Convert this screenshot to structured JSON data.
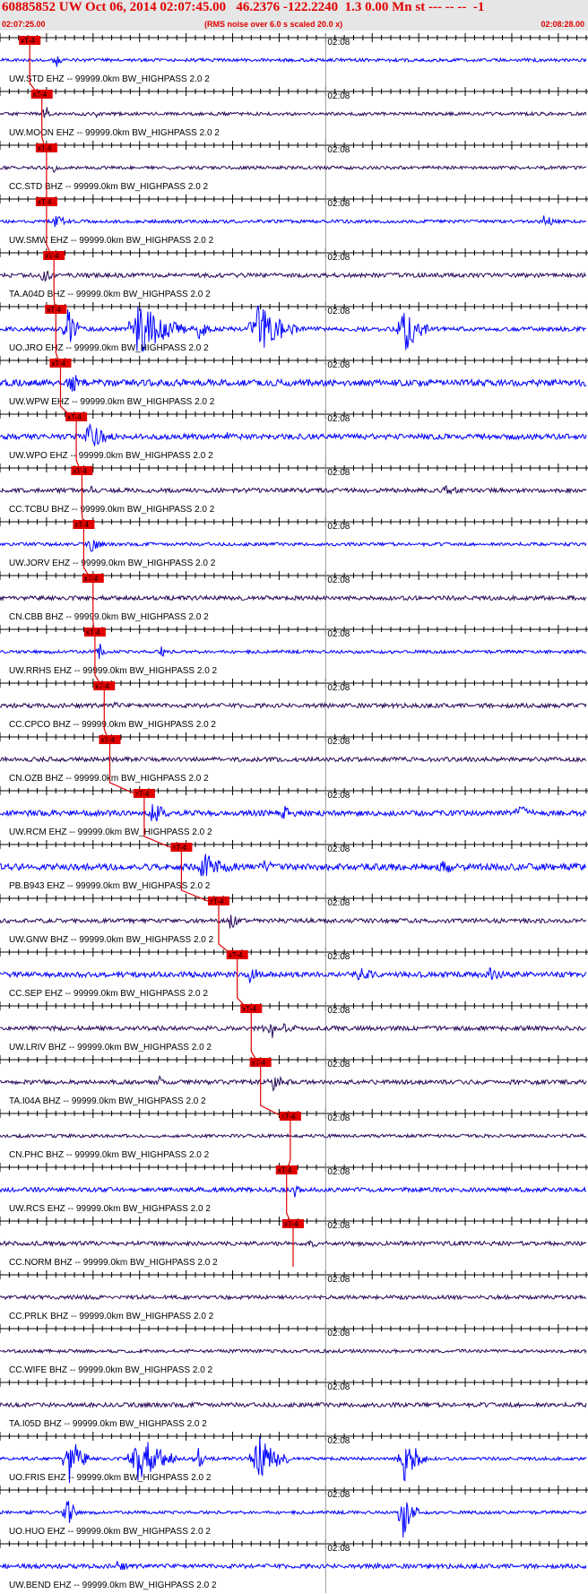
{
  "header": {
    "title": "60885852 UW Oct 06, 2014 02:07:45.00   46.2376 -122.2240  1.3 0.00 Mn st --- -- --  -1",
    "subtitle": "(RMS noise over 6.0 s scaled 20.0 x)",
    "time_start": "02:07:25.00",
    "time_end": "02:08:28.00"
  },
  "chart_data": {
    "type": "line",
    "title": "60885852 UW Oct 06, 2014 02:07:45.00   46.2376 -122.2240  1.3 0.00 Mn st --- -- --  -1",
    "subtitle": "(RMS noise over 6.0 s scaled 20.0 x)",
    "x_range": [
      "02:07:25.00",
      "02:08:28.00"
    ],
    "minute_mark_label": "02:08",
    "pick_label": "xT-4",
    "colors": {
      "trace_blue": "#0000ff",
      "trace_dark": "#2a0a5a",
      "pick": "#e00000",
      "axis": "#000000"
    },
    "traces": [
      {
        "label": "UW.STD EHZ -- 99999.0km BW_HIGHPASS  2.0  2",
        "color": "blue",
        "pick_s": 3.2,
        "amp": 0.15,
        "events": [
          [
            6,
            1.0,
            0.9
          ],
          [
            18,
            0.7,
            0.3
          ],
          [
            45,
            0.8,
            0.3
          ]
        ]
      },
      {
        "label": "UW.MOON EHZ -- 99999.0km BW_HIGHPASS  2.0  2",
        "color": "dark",
        "pick_s": 4.5,
        "amp": 0.15,
        "events": [
          [
            4.8,
            0.6,
            1.2
          ],
          [
            10,
            1.5,
            0.4
          ]
        ]
      },
      {
        "label": "CC.STD BHZ -- 99999.0km BW_HIGHPASS  2.0  2",
        "color": "dark",
        "pick_s": 5.0,
        "amp": 0.15,
        "events": [
          [
            5.5,
            1.5,
            0.5
          ]
        ]
      },
      {
        "label": "UW.SMW EHZ -- 99999.0km BW_HIGHPASS  2.0  2",
        "color": "blue",
        "pick_s": 5.0,
        "amp": 0.15,
        "events": [
          [
            5.5,
            3,
            0.7
          ],
          [
            58,
            3,
            0.6
          ]
        ]
      },
      {
        "label": "TA.A04D BHZ -- 99999.0km BW_HIGHPASS  2.0  2",
        "color": "dark",
        "pick_s": 5.8,
        "amp": 0.2,
        "events": [
          [
            4,
            4,
            0.6
          ]
        ]
      },
      {
        "label": "UO.JRO EHZ -- 99999.0km BW_HIGHPASS  2.0  2",
        "color": "blue",
        "pick_s": 6.0,
        "amp": 0.2,
        "events": [
          [
            7,
            2,
            2.2
          ],
          [
            14,
            6,
            2.6
          ],
          [
            21,
            2,
            1.2
          ],
          [
            27,
            5,
            2.6
          ],
          [
            43,
            3,
            2.6
          ]
        ]
      },
      {
        "label": "UW.WPW EHZ -- 99999.0km BW_HIGHPASS  2.0  2",
        "color": "blue",
        "pick_s": 6.5,
        "amp": 0.3,
        "events": [
          [
            7,
            3,
            1.2
          ]
        ]
      },
      {
        "label": "UW.WPO EHZ -- 99999.0km BW_HIGHPASS  2.0  2",
        "color": "blue",
        "pick_s": 8.2,
        "amp": 0.25,
        "events": [
          [
            9,
            4,
            1.3
          ],
          [
            24,
            2,
            0.5
          ]
        ]
      },
      {
        "label": "CC.TCBU BHZ -- 99999.0km BW_HIGHPASS  2.0  2",
        "color": "dark",
        "pick_s": 8.8,
        "amp": 0.2,
        "events": [
          [
            9.5,
            2,
            0.4
          ],
          [
            47,
            4,
            0.6
          ]
        ]
      },
      {
        "label": "UW.JORV EHZ -- 99999.0km BW_HIGHPASS  2.0  2",
        "color": "blue",
        "pick_s": 9.0,
        "amp": 0.15,
        "events": [
          [
            9.5,
            2,
            0.8
          ]
        ]
      },
      {
        "label": "CN.CBB BHZ -- 99999.0km BW_HIGHPASS  2.0  2",
        "color": "dark",
        "pick_s": 10.0,
        "amp": 0.2,
        "events": []
      },
      {
        "label": "UW.RRHS EHZ -- 99999.0km BW_HIGHPASS  2.0  2",
        "color": "blue",
        "pick_s": 10.2,
        "amp": 0.15,
        "events": [
          [
            10.5,
            1,
            1.0
          ],
          [
            17,
            2,
            0.6
          ]
        ]
      },
      {
        "label": "CC.CPCO BHZ -- 99999.0km BW_HIGHPASS  2.0  2",
        "color": "dark",
        "pick_s": 11.2,
        "amp": 0.2,
        "events": [
          [
            12,
            1.5,
            0.5
          ]
        ]
      },
      {
        "label": "CN.OZB BHZ -- 99999.0km BW_HIGHPASS  2.0  2",
        "color": "dark",
        "pick_s": 11.8,
        "amp": 0.2,
        "events": []
      },
      {
        "label": "UW.RCM EHZ -- 99999.0km BW_HIGHPASS  2.0  2",
        "color": "blue",
        "pick_s": 15.5,
        "amp": 0.25,
        "events": [
          [
            16,
            2.5,
            1.4
          ],
          [
            30,
            3,
            0.8
          ],
          [
            55,
            4,
            0.9
          ]
        ]
      },
      {
        "label": "PB.B943 EHZ -- 99999.0km BW_HIGHPASS  2.0  2",
        "color": "blue",
        "pick_s": 19.5,
        "amp": 0.3,
        "events": [
          [
            21,
            6,
            1.3
          ],
          [
            28,
            3,
            0.7
          ],
          [
            47,
            3,
            0.9
          ]
        ]
      },
      {
        "label": "UW.GNW BHZ -- 99999.0km BW_HIGHPASS  2.0  2",
        "color": "dark",
        "pick_s": 23.5,
        "amp": 0.2,
        "events": [
          [
            24.5,
            1.5,
            1.0
          ],
          [
            14,
            0.8,
            0.5
          ]
        ]
      },
      {
        "label": "CC.SEP EHZ -- 99999.0km BW_HIGHPASS  2.0  2",
        "color": "blue",
        "pick_s": 25.5,
        "amp": 0.25,
        "events": [
          [
            26.5,
            2.5,
            0.9
          ],
          [
            38,
            4,
            0.7
          ],
          [
            52,
            4,
            0.7
          ]
        ]
      },
      {
        "label": "UW.LRIV BHZ -- 99999.0km BW_HIGHPASS  2.0  2",
        "color": "dark",
        "pick_s": 27.0,
        "amp": 0.2,
        "events": [
          [
            28.5,
            4,
            1.1
          ]
        ]
      },
      {
        "label": "TA.I04A BHZ -- 99999.0km BW_HIGHPASS  2.0  2",
        "color": "dark",
        "pick_s": 28.0,
        "amp": 0.2,
        "events": [
          [
            29,
            2.5,
            1.2
          ],
          [
            17,
            1,
            0.6
          ]
        ]
      },
      {
        "label": "CN.PHC BHZ -- 99999.0km BW_HIGHPASS  2.0  2",
        "color": "dark",
        "pick_s": 31.2,
        "amp": 0.15,
        "events": []
      },
      {
        "label": "UW.RCS EHZ -- 99999.0km BW_HIGHPASS  2.0  2",
        "color": "blue",
        "pick_s": 30.8,
        "amp": 0.2,
        "events": [
          [
            31.5,
            1.2,
            0.8
          ]
        ]
      },
      {
        "label": "CC.NORM BHZ -- 99999.0km BW_HIGHPASS  2.0  2",
        "color": "dark",
        "pick_s": 31.5,
        "amp": 0.2,
        "events": [
          [
            33,
            3,
            0.4
          ]
        ]
      },
      {
        "label": "CC.PRLK BHZ -- 99999.0km BW_HIGHPASS  2.0  2",
        "color": "dark",
        "pick_s": null,
        "amp": 0.18,
        "events": []
      },
      {
        "label": "CC.WIFE BHZ -- 99999.0km BW_HIGHPASS  2.0  2",
        "color": "dark",
        "pick_s": null,
        "amp": 0.15,
        "events": []
      },
      {
        "label": "TA.I05D BHZ -- 99999.0km BW_HIGHPASS  2.0  2",
        "color": "dark",
        "pick_s": null,
        "amp": 0.2,
        "events": []
      },
      {
        "label": "UO.FRIS EHZ -- 99999.0km BW_HIGHPASS  2.0  2",
        "color": "blue",
        "pick_s": null,
        "amp": 0.15,
        "events": [
          [
            7,
            2.5,
            2.6
          ],
          [
            14,
            5,
            2.6
          ],
          [
            21,
            1.5,
            1.2
          ],
          [
            27,
            4,
            2.6
          ],
          [
            43,
            3,
            2.6
          ]
        ]
      },
      {
        "label": "UO.HUO EHZ -- 99999.0km BW_HIGHPASS  2.0  2",
        "color": "blue",
        "pick_s": null,
        "amp": 0.15,
        "events": [
          [
            7,
            1.5,
            2.0
          ],
          [
            43,
            2,
            2.6
          ]
        ]
      },
      {
        "label": "UW.BEND EHZ -- 99999.0km BW_HIGHPASS  2.0  2",
        "color": "blue",
        "pick_s": null,
        "amp": 0.2,
        "events": [
          [
            12,
            4,
            0.5
          ],
          [
            40,
            4,
            0.4
          ]
        ]
      }
    ]
  }
}
